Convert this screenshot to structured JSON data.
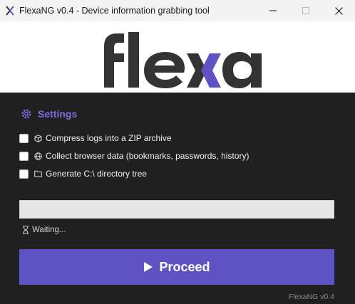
{
  "window": {
    "title": "FlexaNG v0.4 - Device information grabbing tool",
    "controls": [
      "minimize",
      "maximize",
      "close"
    ]
  },
  "logo": {
    "text": "flexa",
    "colors": {
      "text": "#333333",
      "accent": "#5f53c4"
    }
  },
  "settings": {
    "heading": "Settings",
    "icon": "gear-icon",
    "options": [
      {
        "label": "Compress logs into a ZIP archive",
        "icon": "package-icon",
        "checked": false
      },
      {
        "label": "Collect browser data (bookmarks, passwords, history)",
        "icon": "globe-icon",
        "checked": false
      },
      {
        "label": "Generate C:\\ directory tree",
        "icon": "folder-icon",
        "checked": false
      }
    ]
  },
  "progress": {
    "value": 0
  },
  "status": {
    "icon": "hourglass-icon",
    "text": "Waiting..."
  },
  "proceed": {
    "label": "Proceed",
    "icon": "play-icon"
  },
  "footer": {
    "text": "FlexaNG v0.4"
  },
  "colors": {
    "accent": "#5f53c4",
    "background": "#202020",
    "titlebar": "#f3f3f3"
  }
}
